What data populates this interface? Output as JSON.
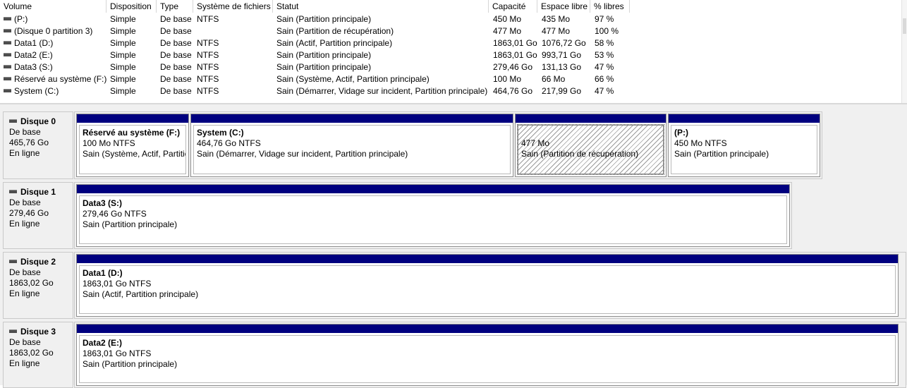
{
  "columns": [
    "Volume",
    "Disposition",
    "Type",
    "Système de fichiers",
    "Statut",
    "Capacité",
    "Espace libre",
    "% libres"
  ],
  "volumes": [
    {
      "volume": "(P:)",
      "disposition": "Simple",
      "type": "De base",
      "fs": "NTFS",
      "status": "Sain (Partition principale)",
      "capacity": "450 Mo",
      "free": "435 Mo",
      "pct": "97 %"
    },
    {
      "volume": "(Disque 0 partition 3)",
      "disposition": "Simple",
      "type": "De base",
      "fs": "",
      "status": "Sain (Partition de récupération)",
      "capacity": "477 Mo",
      "free": "477 Mo",
      "pct": "100 %"
    },
    {
      "volume": "Data1 (D:)",
      "disposition": "Simple",
      "type": "De base",
      "fs": "NTFS",
      "status": "Sain (Actif, Partition principale)",
      "capacity": "1863,01 Go",
      "free": "1076,72 Go",
      "pct": "58 %"
    },
    {
      "volume": "Data2 (E:)",
      "disposition": "Simple",
      "type": "De base",
      "fs": "NTFS",
      "status": "Sain (Partition principale)",
      "capacity": "1863,01 Go",
      "free": "993,71 Go",
      "pct": "53 %"
    },
    {
      "volume": "Data3 (S:)",
      "disposition": "Simple",
      "type": "De base",
      "fs": "NTFS",
      "status": "Sain (Partition principale)",
      "capacity": "279,46 Go",
      "free": "131,13 Go",
      "pct": "47 %"
    },
    {
      "volume": "Réservé au système (F:)",
      "disposition": "Simple",
      "type": "De base",
      "fs": "NTFS",
      "status": "Sain (Système, Actif, Partition principale)",
      "capacity": "100 Mo",
      "free": "66 Mo",
      "pct": "66 %"
    },
    {
      "volume": "System (C:)",
      "disposition": "Simple",
      "type": "De base",
      "fs": "NTFS",
      "status": "Sain (Démarrer, Vidage sur incident, Partition principale)",
      "capacity": "464,76 Go",
      "free": "217,99 Go",
      "pct": "47 %"
    }
  ],
  "disks": [
    {
      "name": "Disque 0",
      "type": "De base",
      "size": "465,76 Go",
      "state": "En ligne",
      "partitions": [
        {
          "name": "Réservé au système  (F:)",
          "size": "100 Mo NTFS",
          "status": "Sain (Système, Actif, Partitic",
          "hatched": false
        },
        {
          "name": "System  (C:)",
          "size": "464,76 Go NTFS",
          "status": "Sain (Démarrer, Vidage sur incident, Partition principale)",
          "hatched": false
        },
        {
          "name": "",
          "size": "477 Mo",
          "status": "Sain (Partition de récupération)",
          "hatched": true
        },
        {
          "name": "(P:)",
          "size": "450 Mo NTFS",
          "status": "Sain (Partition principale)",
          "hatched": false
        }
      ]
    },
    {
      "name": "Disque 1",
      "type": "De base",
      "size": "279,46 Go",
      "state": "En ligne",
      "partitions": [
        {
          "name": "Data3  (S:)",
          "size": "279,46 Go NTFS",
          "status": "Sain (Partition principale)",
          "hatched": false
        }
      ]
    },
    {
      "name": "Disque 2",
      "type": "De base",
      "size": "1863,02 Go",
      "state": "En ligne",
      "partitions": [
        {
          "name": "Data1  (D:)",
          "size": "1863,01 Go NTFS",
          "status": "Sain (Actif, Partition principale)",
          "hatched": false
        }
      ]
    },
    {
      "name": "Disque 3",
      "type": "De base",
      "size": "1863,02 Go",
      "state": "En ligne",
      "partitions": [
        {
          "name": "Data2  (E:)",
          "size": "1863,01 Go NTFS",
          "status": "Sain (Partition principale)",
          "hatched": false
        }
      ]
    }
  ],
  "icons": {
    "drive": "drive-icon",
    "disk": "disk-icon"
  },
  "colors": {
    "partition_bar": "#00007f",
    "background": "#f0f0f0"
  }
}
